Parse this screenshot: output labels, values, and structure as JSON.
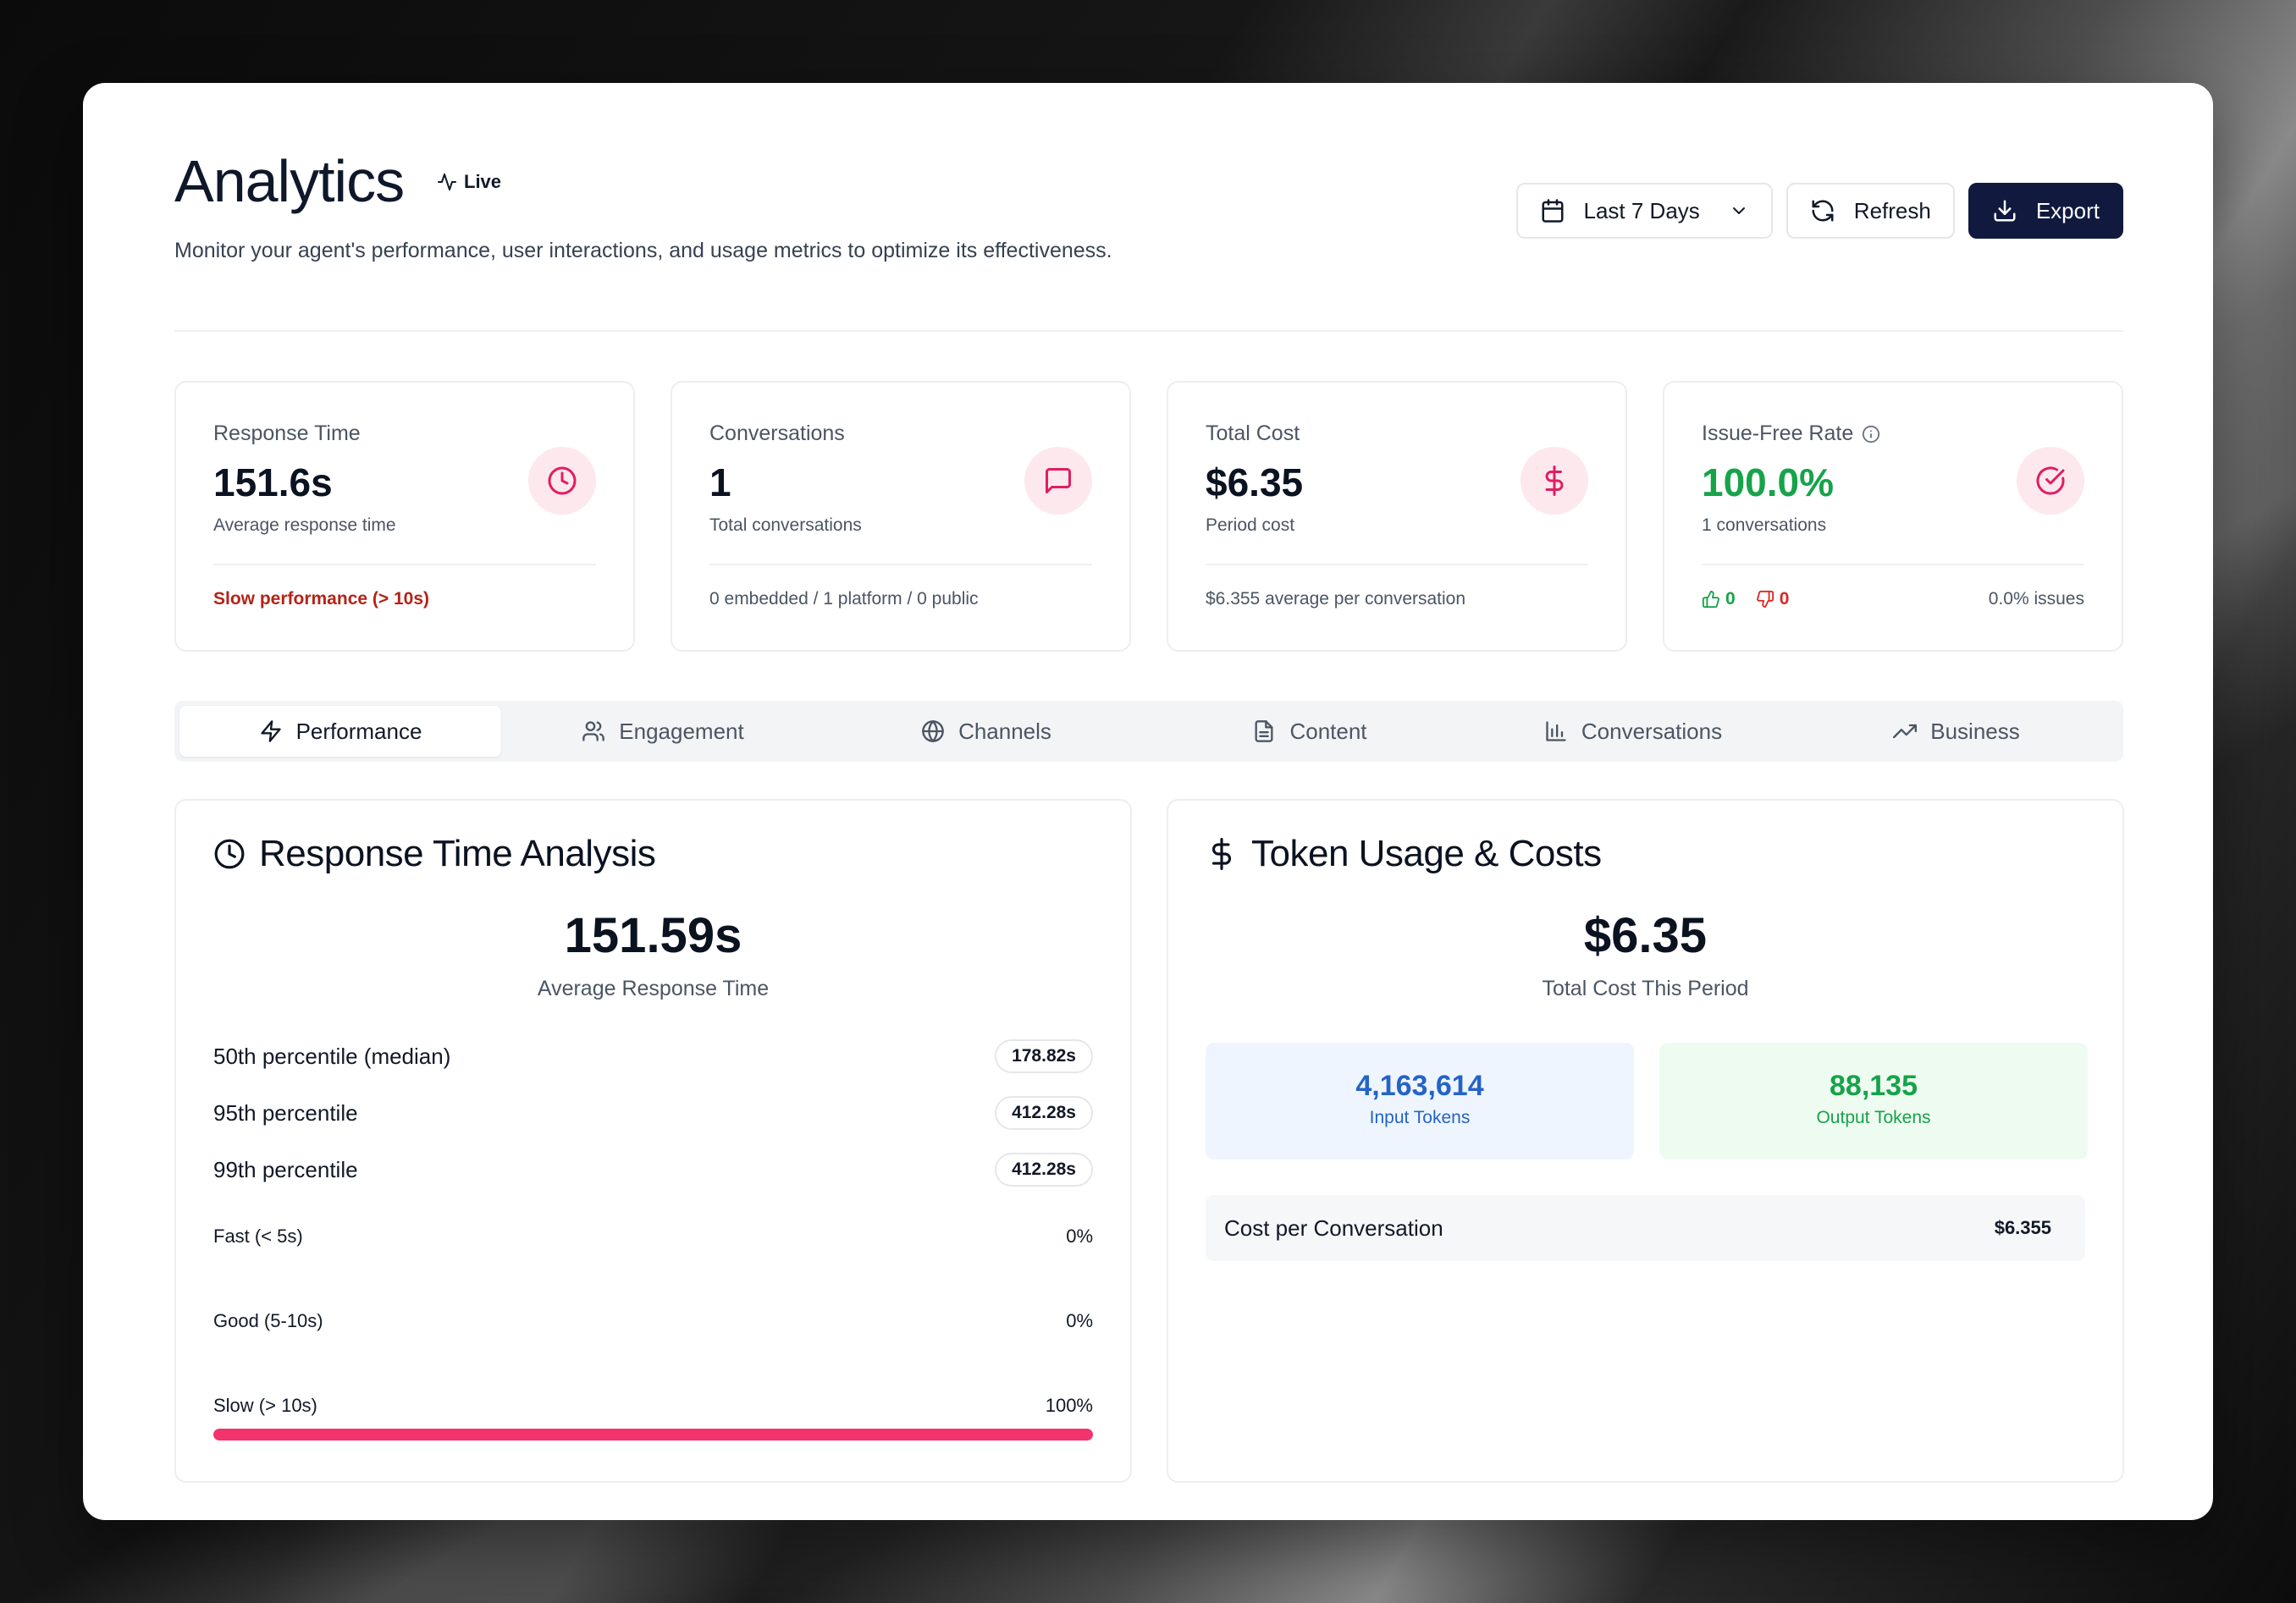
{
  "header": {
    "title": "Analytics",
    "live_label": "Live",
    "subtitle": "Monitor your agent's performance, user interactions, and usage metrics to optimize its effectiveness.",
    "date_range": "Last 7 Days",
    "refresh_label": "Refresh",
    "export_label": "Export"
  },
  "stats": [
    {
      "label": "Response Time",
      "value": "151.6s",
      "sub": "Average response time",
      "footer": "Slow performance (> 10s)",
      "icon": "clock-icon"
    },
    {
      "label": "Conversations",
      "value": "1",
      "sub": "Total conversations",
      "footer": "0 embedded / 1 platform / 0 public",
      "icon": "message-square-icon"
    },
    {
      "label": "Total Cost",
      "value": "$6.35",
      "sub": "Period cost",
      "footer": "$6.355 average per conversation",
      "icon": "dollar-sign-icon"
    },
    {
      "label": "Issue-Free Rate",
      "value": "100.0%",
      "sub": "1 conversations",
      "thumbs_up": "0",
      "thumbs_down": "0",
      "footer": "0.0% issues",
      "icon": "check-circle-icon"
    }
  ],
  "tabs": [
    {
      "label": "Performance",
      "icon": "zap-icon"
    },
    {
      "label": "Engagement",
      "icon": "users-icon"
    },
    {
      "label": "Channels",
      "icon": "globe-icon"
    },
    {
      "label": "Content",
      "icon": "file-text-icon"
    },
    {
      "label": "Conversations",
      "icon": "bar-chart-icon"
    },
    {
      "label": "Business",
      "icon": "trending-up-icon"
    }
  ],
  "response_panel": {
    "title": "Response Time Analysis",
    "value": "151.59s",
    "value_label": "Average Response Time",
    "percentiles": [
      {
        "label": "50th percentile (median)",
        "value": "178.82s"
      },
      {
        "label": "95th percentile",
        "value": "412.28s"
      },
      {
        "label": "99th percentile",
        "value": "412.28s"
      }
    ],
    "distribution": [
      {
        "label": "Fast (< 5s)",
        "value": "0%",
        "fraction": 0
      },
      {
        "label": "Good (5-10s)",
        "value": "0%",
        "fraction": 0
      },
      {
        "label": "Slow (> 10s)",
        "value": "100%",
        "fraction": 1
      }
    ]
  },
  "token_panel": {
    "title": "Token Usage & Costs",
    "value": "$6.35",
    "value_label": "Total Cost This Period",
    "input_tokens": "4,163,614",
    "input_label": "Input Tokens",
    "output_tokens": "88,135",
    "output_label": "Output Tokens",
    "cpc_label": "Cost per Conversation",
    "cpc_value": "$6.355"
  },
  "colors": {
    "accent_dark": "#111a3e",
    "pink": "#f2336d",
    "green": "#16a34a",
    "blue": "#2563c7",
    "red": "#b42318"
  }
}
